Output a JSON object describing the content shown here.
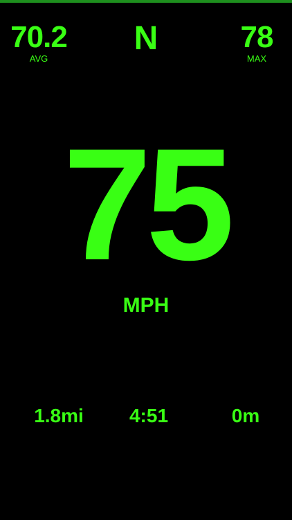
{
  "colors": {
    "background": "#000000",
    "accent": "#39FF14",
    "top_bar": "#1E8F1E"
  },
  "stats": {
    "avg": {
      "value": "70.2",
      "label": "AVG"
    },
    "max": {
      "value": "78",
      "label": "MAX"
    }
  },
  "heading": {
    "direction": "N"
  },
  "speed": {
    "value": "75",
    "unit": "MPH"
  },
  "bottom": {
    "distance": "1.8mi",
    "time": "4:51",
    "altitude": "0m"
  }
}
